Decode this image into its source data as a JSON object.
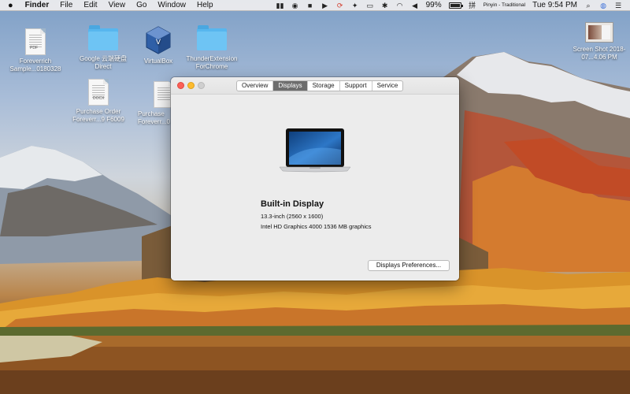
{
  "menubar": {
    "apple_icon": "",
    "app_name": "Finder",
    "menus": [
      "File",
      "Edit",
      "View",
      "Go",
      "Window",
      "Help"
    ],
    "status_icons": [
      "onedrive-icon",
      "shield-icon",
      "screen-recorder-icon",
      "video-icon",
      "sync-icon",
      "bird-icon",
      "screen-share-icon",
      "bluetooth-icon",
      "wifi-icon",
      "volume-icon",
      "battery-icon",
      "input-source-icon"
    ],
    "battery_percent": "99%",
    "battery_level": 0.99,
    "input_source": "Pinyin - Traditional",
    "clock": "Tue 9:54 PM"
  },
  "desktop_icons": [
    {
      "label": "Foreverrich Sample...0180328",
      "kind": "document",
      "tag": "PDF"
    },
    {
      "label": "Google 云端硬盘 Direct",
      "kind": "folder"
    },
    {
      "label": "VirtualBox",
      "kind": "app"
    },
    {
      "label": "ThunderExtension ForChrome",
      "kind": "folder"
    },
    {
      "label": "Purchase Order Foreverr...9 F6009",
      "kind": "document",
      "tag": "DOCX"
    },
    {
      "label": "Purchase Foreverr...0",
      "kind": "document",
      "tag": ""
    },
    {
      "label": "Screen Shot 2018-07...4.06 PM",
      "kind": "screenshot"
    }
  ],
  "window": {
    "tabs": [
      "Overview",
      "Displays",
      "Storage",
      "Support",
      "Service"
    ],
    "active_tab": "Displays",
    "display_name": "Built-in Display",
    "display_size": "13.3-inch (2560 x 1600)",
    "graphics": "Intel HD Graphics 4000 1536 MB graphics",
    "prefs_button": "Displays Preferences..."
  },
  "colors": {
    "close": "#fc5f57",
    "minimize": "#fdbc2e",
    "zoom": "#cfcfcf",
    "active_tab": "#6d6d6d",
    "folder": "#6ec4f4"
  }
}
